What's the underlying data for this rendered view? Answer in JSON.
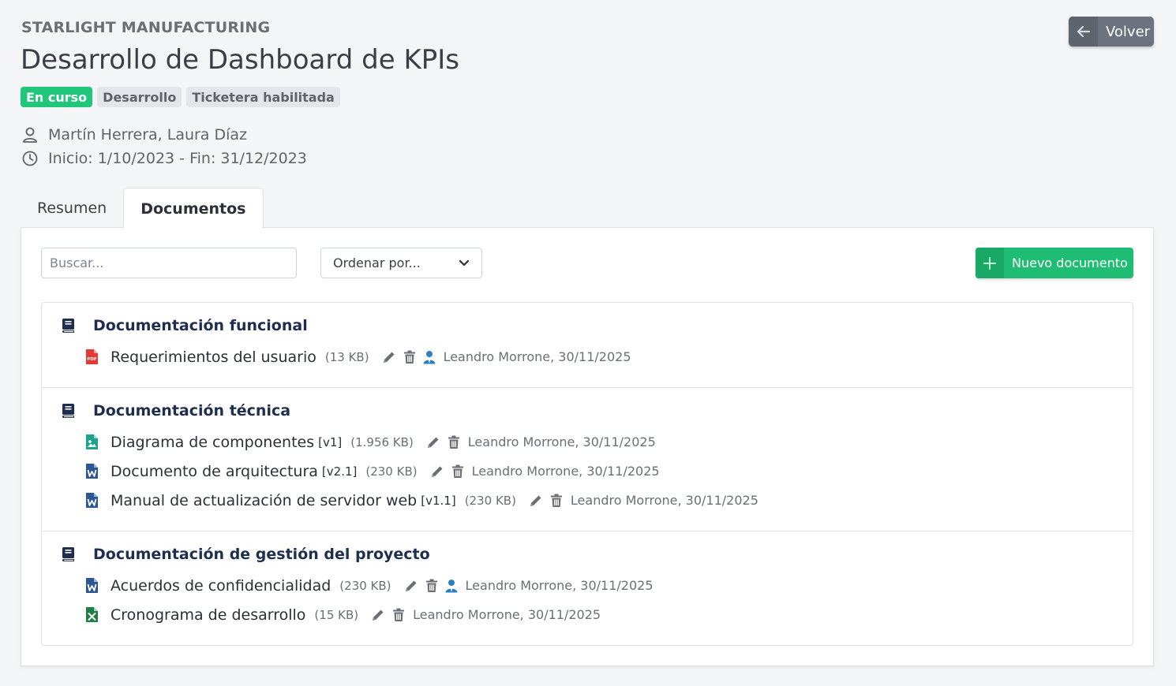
{
  "header": {
    "company": "STARLIGHT MANUFACTURING",
    "title": "Desarrollo de Dashboard de KPIs",
    "back_label": "Volver",
    "badges": [
      "En curso",
      "Desarrollo",
      "Ticketera habilitada"
    ],
    "people": "Martín Herrera, Laura Díaz",
    "dates": "Inicio: 1/10/2023 - Fin: 31/12/2023"
  },
  "tabs": [
    {
      "label": "Resumen",
      "active": false
    },
    {
      "label": "Documentos",
      "active": true
    }
  ],
  "toolbar": {
    "search_placeholder": "Buscar...",
    "sort_label": "Ordenar por...",
    "new_label": "Nuevo documento"
  },
  "sections": [
    {
      "title": "Documentación funcional",
      "docs": [
        {
          "icon": "pdf-file-icon",
          "name": "Requerimientos del usuario",
          "version": "",
          "size": "(13 KB)",
          "owner_icon": true,
          "meta": "Leandro Morrone, 30/11/2025"
        }
      ]
    },
    {
      "title": "Documentación técnica",
      "docs": [
        {
          "icon": "image-file-icon",
          "name": "Diagrama de componentes",
          "version": "[v1]",
          "size": "(1.956 KB)",
          "owner_icon": false,
          "meta": "Leandro Morrone, 30/11/2025"
        },
        {
          "icon": "word-file-icon",
          "name": "Documento de arquitectura",
          "version": "[v2.1]",
          "size": "(230 KB)",
          "owner_icon": false,
          "meta": "Leandro Morrone, 30/11/2025"
        },
        {
          "icon": "word-file-icon",
          "name": "Manual de actualización de servidor web",
          "version": "[v1.1]",
          "size": "(230 KB)",
          "owner_icon": false,
          "meta": "Leandro Morrone, 30/11/2025"
        }
      ]
    },
    {
      "title": "Documentación de gestión del proyecto",
      "docs": [
        {
          "icon": "word-file-icon",
          "name": "Acuerdos de confidencialidad",
          "version": "",
          "size": "(230 KB)",
          "owner_icon": true,
          "meta": "Leandro Morrone, 30/11/2025"
        },
        {
          "icon": "excel-file-icon",
          "name": "Cronograma de desarrollo",
          "version": "",
          "size": "(15 KB)",
          "owner_icon": false,
          "meta": "Leandro Morrone, 30/11/2025"
        }
      ]
    }
  ],
  "colors": {
    "accent_green": "#1fbd74",
    "section_title": "#1f2d4f",
    "pdf": "#e53935",
    "word": "#2b5797",
    "excel": "#1e7e45",
    "image": "#1aa58c"
  }
}
